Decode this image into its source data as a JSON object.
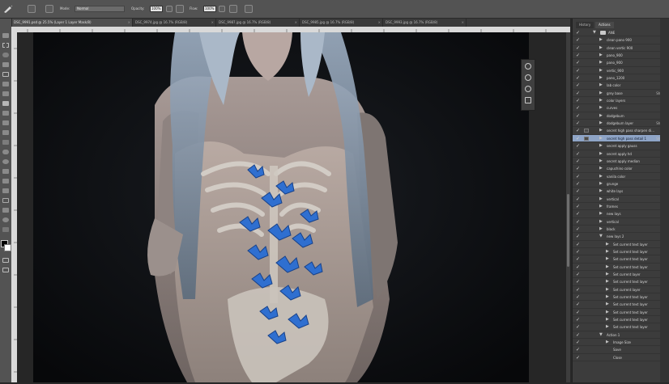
{
  "options_bar": {
    "mode_label": "Mode:",
    "mode_value": "Normal",
    "opacity_label": "Opacity:",
    "opacity_value": "100%",
    "flow_label": "Flow:",
    "flow_value": "100%"
  },
  "doc_tabs": [
    {
      "label": "DSC_9991.psd @ 25.5% (Layer 1 Layer Mask/8)",
      "active": true
    },
    {
      "label": "DSC_9974.jpg @ 16.7% (RGB/8)",
      "active": false
    },
    {
      "label": "DSC_9987.jpg @ 16.7% (RGB/8)",
      "active": false
    },
    {
      "label": "DSC_9985.jpg @ 16.7% (RGB/8)",
      "active": false
    },
    {
      "label": "DSC_9993.jpg @ 16.7% (RGB/8)",
      "active": false
    }
  ],
  "panel_tabs": [
    "History",
    "Actions"
  ],
  "actions": [
    {
      "check": "✓",
      "modal": false,
      "indent": 0,
      "toggle": "▼",
      "folder": true,
      "label": "ANE",
      "shortcut": ""
    },
    {
      "check": "✓",
      "modal": false,
      "indent": 1,
      "toggle": "▶",
      "folder": false,
      "label": "clean pano 900",
      "shortcut": ""
    },
    {
      "check": "✓",
      "modal": false,
      "indent": 1,
      "toggle": "▶",
      "folder": false,
      "label": "clean vertic 900",
      "shortcut": ""
    },
    {
      "check": "✓",
      "modal": false,
      "indent": 1,
      "toggle": "▶",
      "folder": false,
      "label": "pano_900",
      "shortcut": ""
    },
    {
      "check": "✓",
      "modal": false,
      "indent": 1,
      "toggle": "▶",
      "folder": false,
      "label": "pano_900",
      "shortcut": ""
    },
    {
      "check": "✓",
      "modal": false,
      "indent": 1,
      "toggle": "▶",
      "folder": false,
      "label": "vertic_900",
      "shortcut": ""
    },
    {
      "check": "✓",
      "modal": false,
      "indent": 1,
      "toggle": "▶",
      "folder": false,
      "label": "pano_1200",
      "shortcut": ""
    },
    {
      "check": "✓",
      "modal": false,
      "indent": 1,
      "toggle": "▶",
      "folder": false,
      "label": "lab color",
      "shortcut": ""
    },
    {
      "check": "✓",
      "modal": false,
      "indent": 1,
      "toggle": "▶",
      "folder": false,
      "label": "grey base",
      "shortcut": "Shift+F"
    },
    {
      "check": "✓",
      "modal": false,
      "indent": 1,
      "toggle": "▶",
      "folder": false,
      "label": "color layers",
      "shortcut": ""
    },
    {
      "check": "✓",
      "modal": false,
      "indent": 1,
      "toggle": "▶",
      "folder": false,
      "label": "curves",
      "shortcut": ""
    },
    {
      "check": "✓",
      "modal": false,
      "indent": 1,
      "toggle": "▶",
      "folder": false,
      "label": "dodgeburn",
      "shortcut": ""
    },
    {
      "check": "✓",
      "modal": false,
      "indent": 1,
      "toggle": "▶",
      "folder": false,
      "label": "dodgeburn layer",
      "shortcut": "Shift+F"
    },
    {
      "check": "✓",
      "modal": true,
      "indent": 1,
      "toggle": "▶",
      "folder": false,
      "label": "secret high pass sharpen di...",
      "shortcut": ""
    },
    {
      "check": "✓",
      "modal": true,
      "indent": 1,
      "toggle": "▶",
      "folder": false,
      "label": "secret high pass detail 1",
      "shortcut": "Shift+F",
      "selected": true
    },
    {
      "check": "✓",
      "modal": false,
      "indent": 1,
      "toggle": "▶",
      "folder": false,
      "label": "secret apply gauss",
      "shortcut": ""
    },
    {
      "check": "✓",
      "modal": false,
      "indent": 1,
      "toggle": "▶",
      "folder": false,
      "label": "secret apply hd",
      "shortcut": ""
    },
    {
      "check": "✓",
      "modal": false,
      "indent": 1,
      "toggle": "▶",
      "folder": false,
      "label": "secret apply median",
      "shortcut": ""
    },
    {
      "check": "✓",
      "modal": false,
      "indent": 1,
      "toggle": "▶",
      "folder": false,
      "label": "capuchino color",
      "shortcut": ""
    },
    {
      "check": "✓",
      "modal": false,
      "indent": 1,
      "toggle": "▶",
      "folder": false,
      "label": "vanila color",
      "shortcut": ""
    },
    {
      "check": "✓",
      "modal": false,
      "indent": 1,
      "toggle": "▶",
      "folder": false,
      "label": "grunge",
      "shortcut": ""
    },
    {
      "check": "✓",
      "modal": false,
      "indent": 1,
      "toggle": "▶",
      "folder": false,
      "label": "white lays",
      "shortcut": ""
    },
    {
      "check": "✓",
      "modal": false,
      "indent": 1,
      "toggle": "▶",
      "folder": false,
      "label": "vertical",
      "shortcut": ""
    },
    {
      "check": "✓",
      "modal": false,
      "indent": 1,
      "toggle": "▶",
      "folder": false,
      "label": "frames",
      "shortcut": ""
    },
    {
      "check": "✓",
      "modal": false,
      "indent": 1,
      "toggle": "▶",
      "folder": false,
      "label": "new lays",
      "shortcut": ""
    },
    {
      "check": "✓",
      "modal": false,
      "indent": 1,
      "toggle": "▶",
      "folder": false,
      "label": "vertical",
      "shortcut": ""
    },
    {
      "check": "✓",
      "modal": false,
      "indent": 1,
      "toggle": "▶",
      "folder": false,
      "label": "black",
      "shortcut": ""
    },
    {
      "check": "✓",
      "modal": false,
      "indent": 1,
      "toggle": "▼",
      "folder": false,
      "label": "new lays 2",
      "shortcut": ""
    },
    {
      "check": "✓",
      "modal": false,
      "indent": 2,
      "toggle": "▶",
      "folder": false,
      "label": "Set current text layer",
      "shortcut": ""
    },
    {
      "check": "✓",
      "modal": false,
      "indent": 2,
      "toggle": "▶",
      "folder": false,
      "label": "Set current text layer",
      "shortcut": ""
    },
    {
      "check": "✓",
      "modal": false,
      "indent": 2,
      "toggle": "▶",
      "folder": false,
      "label": "Set current text layer",
      "shortcut": ""
    },
    {
      "check": "✓",
      "modal": false,
      "indent": 2,
      "toggle": "▶",
      "folder": false,
      "label": "Set current text layer",
      "shortcut": ""
    },
    {
      "check": "✓",
      "modal": false,
      "indent": 2,
      "toggle": "▶",
      "folder": false,
      "label": "Set current layer",
      "shortcut": ""
    },
    {
      "check": "✓",
      "modal": false,
      "indent": 2,
      "toggle": "▶",
      "folder": false,
      "label": "Set current text layer",
      "shortcut": ""
    },
    {
      "check": "✓",
      "modal": false,
      "indent": 2,
      "toggle": "▶",
      "folder": false,
      "label": "Set current layer",
      "shortcut": ""
    },
    {
      "check": "✓",
      "modal": false,
      "indent": 2,
      "toggle": "▶",
      "folder": false,
      "label": "Set current text layer",
      "shortcut": ""
    },
    {
      "check": "✓",
      "modal": false,
      "indent": 2,
      "toggle": "▶",
      "folder": false,
      "label": "Set current text layer",
      "shortcut": ""
    },
    {
      "check": "✓",
      "modal": false,
      "indent": 2,
      "toggle": "▶",
      "folder": false,
      "label": "Set current text layer",
      "shortcut": ""
    },
    {
      "check": "✓",
      "modal": false,
      "indent": 2,
      "toggle": "▶",
      "folder": false,
      "label": "Set current text layer",
      "shortcut": ""
    },
    {
      "check": "✓",
      "modal": false,
      "indent": 2,
      "toggle": "▶",
      "folder": false,
      "label": "Set current text layer",
      "shortcut": ""
    },
    {
      "check": "✓",
      "modal": false,
      "indent": 1,
      "toggle": "▼",
      "folder": false,
      "label": "Action 1",
      "shortcut": ""
    },
    {
      "check": "✓",
      "modal": false,
      "indent": 2,
      "toggle": "▶",
      "folder": false,
      "label": "Image Size",
      "shortcut": ""
    },
    {
      "check": "✓",
      "modal": false,
      "indent": 2,
      "toggle": "",
      "folder": false,
      "label": "Save",
      "shortcut": ""
    },
    {
      "check": "✓",
      "modal": false,
      "indent": 2,
      "toggle": "",
      "folder": false,
      "label": "Close",
      "shortcut": ""
    }
  ],
  "colors": {
    "selected_row": "#8ea4c6",
    "butterfly_blue": "#2f6fd0",
    "hair": "#8a9db4"
  }
}
